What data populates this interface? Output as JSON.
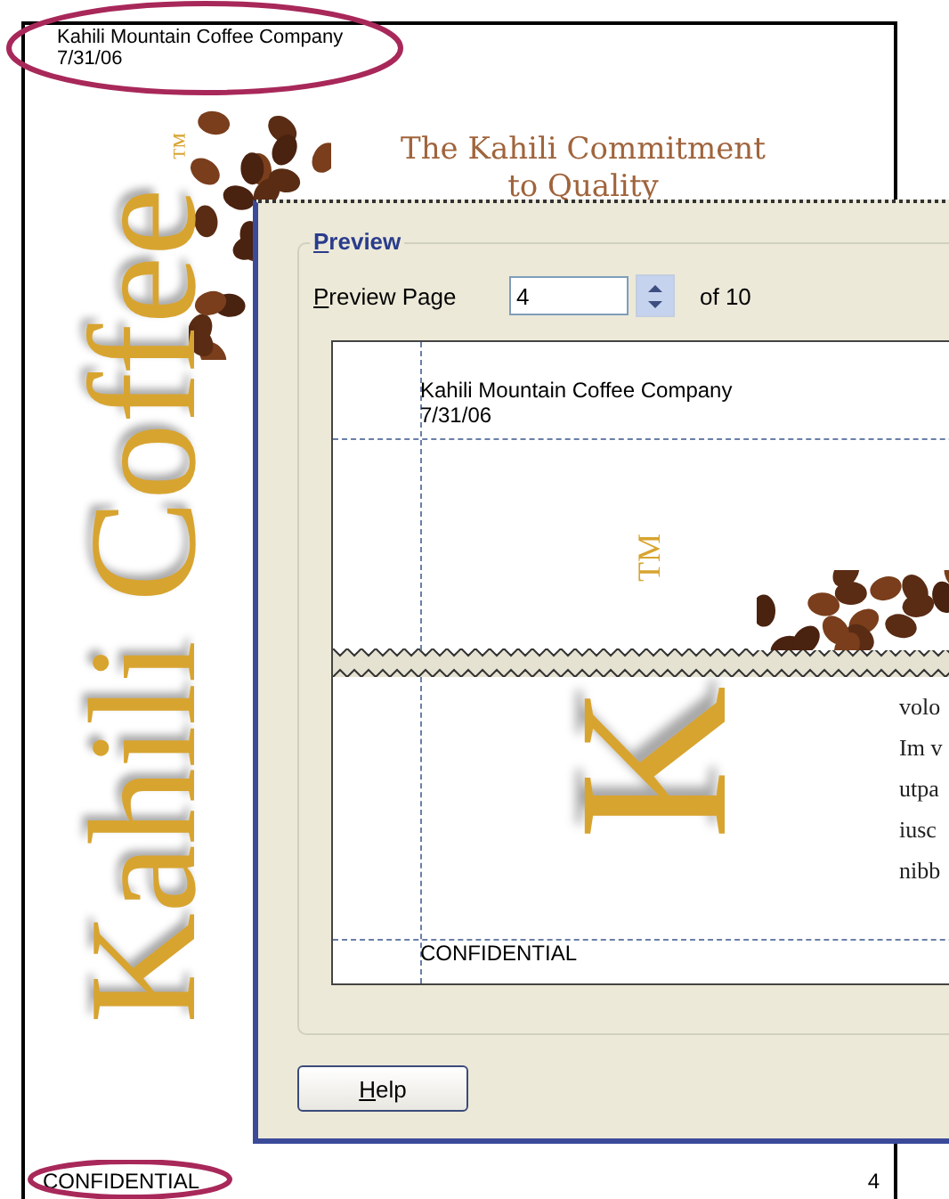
{
  "page": {
    "header": [
      "Kahili Mountain Coffee Company",
      "7/31/06"
    ],
    "logo": "Kahili Coffee",
    "trademark": "™",
    "headline": [
      "The Kahili Commitment",
      "to Quality"
    ],
    "footer": "CONFIDENTIAL",
    "page_number": "4"
  },
  "dialog": {
    "group_title": "Preview",
    "page_label": "Preview Page",
    "page_value": "4",
    "page_total": "of 10",
    "preview": {
      "header": [
        "Kahili Mountain Coffee Company",
        "7/31/06"
      ],
      "trademark": "TM",
      "logo_letter": "K",
      "body_lines": [
        "volo",
        "Im v",
        "utpa",
        "iusc",
        "nibb"
      ],
      "footer": "CONFIDENTIAL"
    },
    "buttons": [
      "Help"
    ]
  }
}
